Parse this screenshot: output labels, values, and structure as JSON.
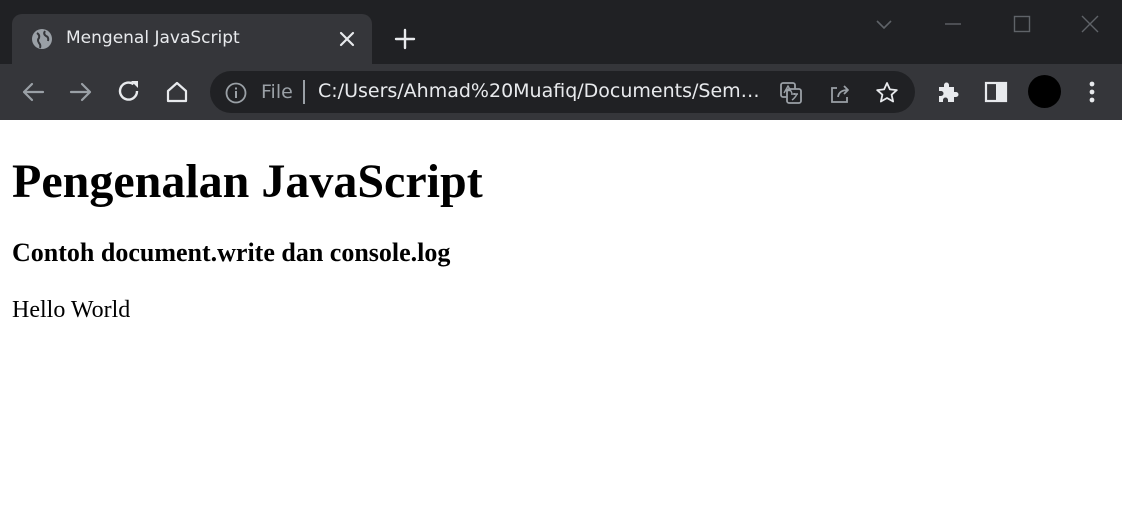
{
  "browser": {
    "tab": {
      "title": "Mengenal JavaScript"
    },
    "address_bar": {
      "scheme_label": "File",
      "url": "C:/Users/Ahmad%20Muafiq/Documents/Semester..."
    }
  },
  "page": {
    "heading": "Pengenalan JavaScript",
    "subheading": "Contoh document.write dan console.log",
    "body_text": "Hello World"
  },
  "colors": {
    "titlebar": "#202124",
    "toolbar": "#35363a",
    "omnibox": "#202124",
    "icon": "#e8eaed",
    "icon_dim": "#9aa0a6"
  }
}
